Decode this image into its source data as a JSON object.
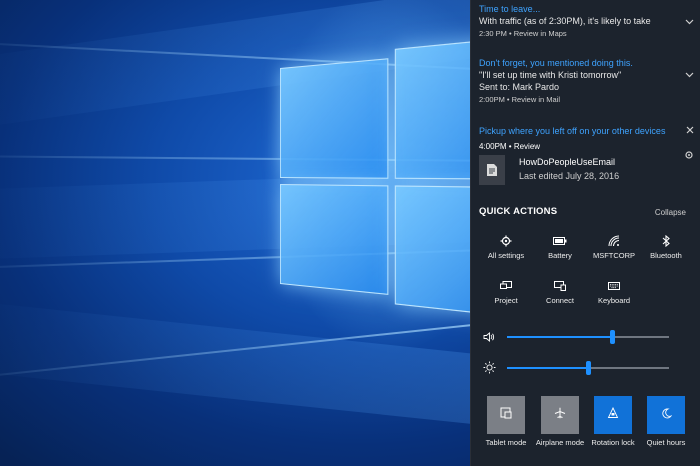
{
  "notifications": [
    {
      "title": "Time to leave...",
      "line1": "With traffic (as of 2:30PM), it's likely to take",
      "meta": "2:30 PM • Review in Maps"
    },
    {
      "title": "Don't forget, you mentioned doing this.",
      "line1": "\"I'll set up time with Kristi tomorrow\"",
      "line2": "Sent to: Mark Pardo",
      "meta": "2:00PM • Review in Mail"
    },
    {
      "title": "Pickup where you left off on your other devices",
      "meta": "4:00PM • Review",
      "doc_name": "HowDoPeopleUseEmail",
      "doc_date": "Last edited July 28, 2016"
    }
  ],
  "quick_actions": {
    "header": "QUICK ACTIONS",
    "collapse_label": "Collapse",
    "items": [
      {
        "label": "All settings",
        "icon": "gear-icon"
      },
      {
        "label": "Battery",
        "icon": "battery-icon"
      },
      {
        "label": "MSFTCORP",
        "icon": "wifi-icon"
      },
      {
        "label": "Bluetooth",
        "icon": "bluetooth-icon"
      },
      {
        "label": "Project",
        "icon": "project-icon"
      },
      {
        "label": "Connect",
        "icon": "connect-icon"
      },
      {
        "label": "Keyboard",
        "icon": "keyboard-icon"
      }
    ],
    "volume_level": 0.65,
    "brightness_level": 0.5,
    "tiles": [
      {
        "label": "Tablet mode",
        "state": "off",
        "icon": "tablet-icon"
      },
      {
        "label": "Airplane mode",
        "state": "off",
        "icon": "airplane-icon"
      },
      {
        "label": "Rotation lock",
        "state": "on",
        "icon": "rotation-lock-icon"
      },
      {
        "label": "Quiet hours",
        "state": "on",
        "icon": "moon-icon"
      }
    ]
  },
  "colors": {
    "accent": "#1e90ff",
    "notification_title": "#3ea3ff",
    "tile_on": "#1172d8",
    "tile_off": "#7b7f86",
    "panel_bg": "#1e222a"
  }
}
